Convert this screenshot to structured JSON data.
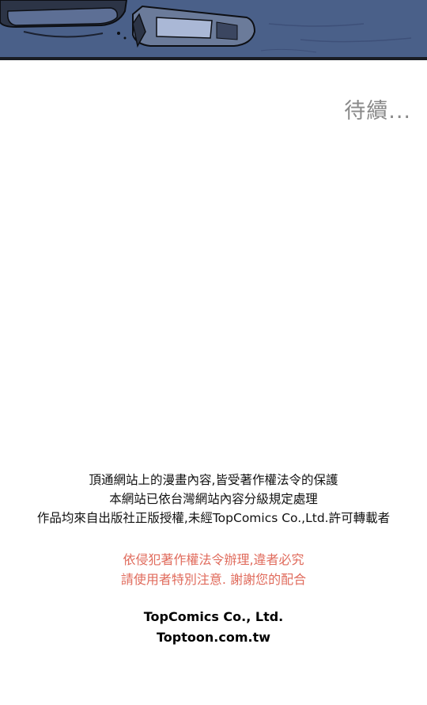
{
  "continued_text": "待續...",
  "copyright_notice": {
    "lines": [
      "頂通網站上的漫畫內容,皆受著作權法令的保護",
      "本網站已依台灣網站內容分級規定處理",
      "作品均來自出版社正版授權,未經TopComics Co.,Ltd.許可轉載者"
    ]
  },
  "warning_notice": {
    "lines": [
      "依侵犯著作權法令辦理,違者必究",
      "請使用者特別注意. 謝謝您的配合"
    ],
    "color": "#e06b5c"
  },
  "brand": {
    "company": "TopComics Co., Ltd.",
    "website": "Toptoon.com.tw"
  }
}
